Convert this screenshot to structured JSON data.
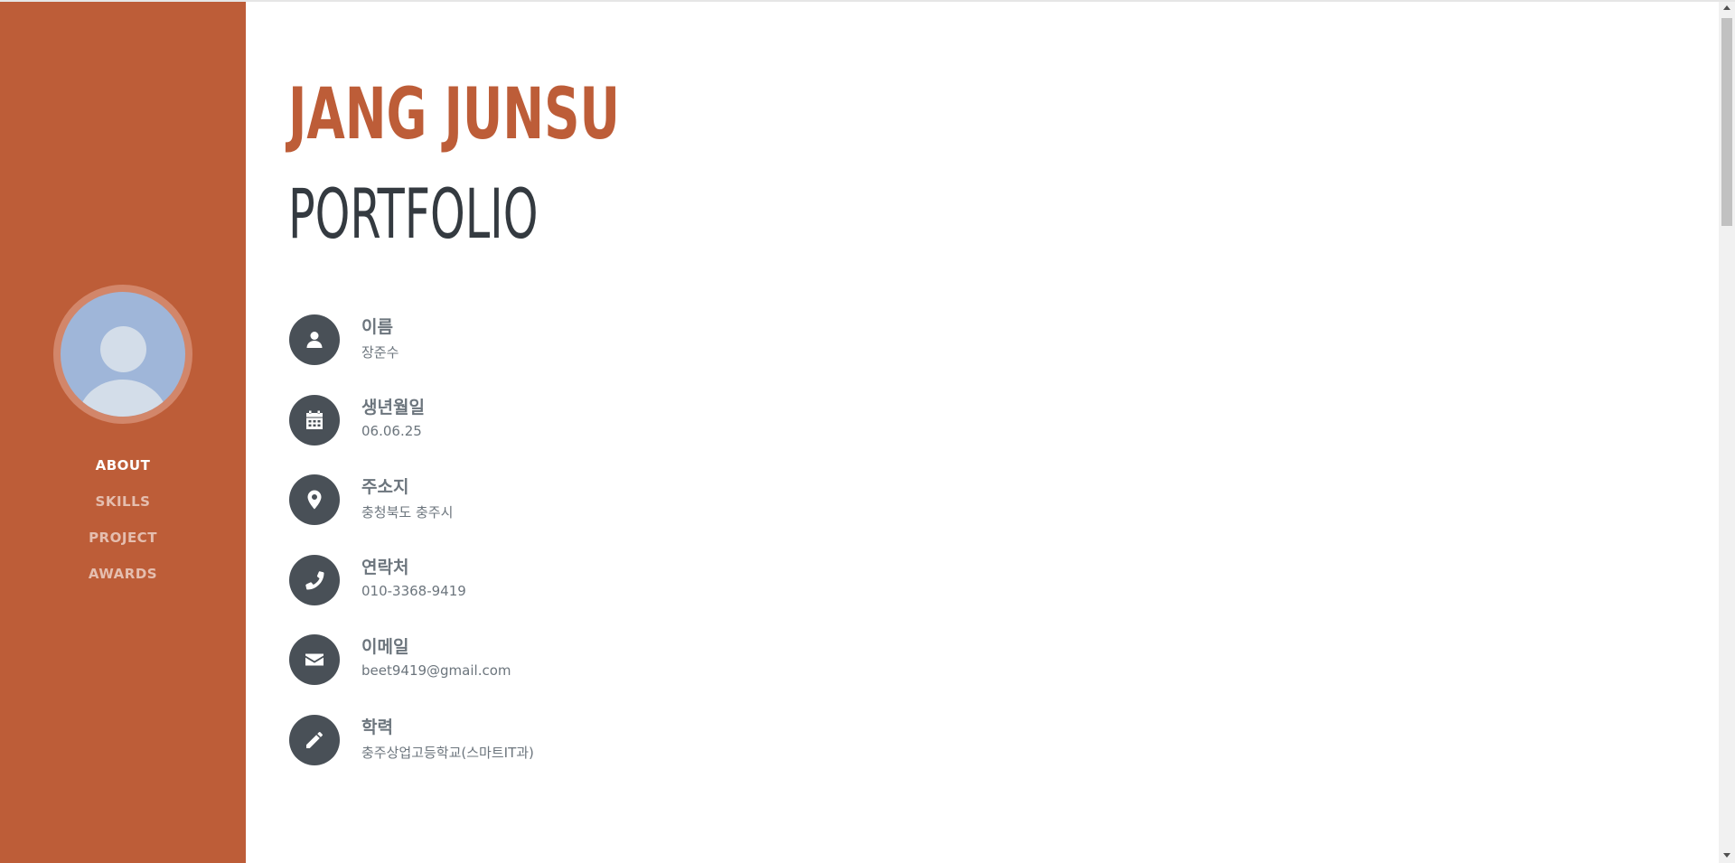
{
  "sidebar": {
    "avatar_icon": "user-avatar-placeholder",
    "nav": [
      {
        "label": "ABOUT",
        "active": true
      },
      {
        "label": "SKILLS",
        "active": false
      },
      {
        "label": "PROJECT",
        "active": false
      },
      {
        "label": "AWARDS",
        "active": false
      }
    ]
  },
  "header": {
    "first_name": "JANG JUNSU",
    "last_name": "PORTFOLIO"
  },
  "info": [
    {
      "icon": "user-icon",
      "label": "이름",
      "value": "장준수"
    },
    {
      "icon": "calendar-icon",
      "label": "생년월일",
      "value": "06.06.25"
    },
    {
      "icon": "map-marker-icon",
      "label": "주소지",
      "value": "충청북도 충주시"
    },
    {
      "icon": "phone-icon",
      "label": "연락처",
      "value": "010-3368-9419"
    },
    {
      "icon": "envelope-icon",
      "label": "이메일",
      "value": "beet9419@gmail.com"
    },
    {
      "icon": "pencil-icon",
      "label": "학력",
      "value": "충주상업고등학교(스마트IT과)"
    }
  ],
  "colors": {
    "primary": "#bd5d38",
    "icon_bg": "#495057",
    "text_dark": "#343a40",
    "text_muted": "#6c757d"
  }
}
